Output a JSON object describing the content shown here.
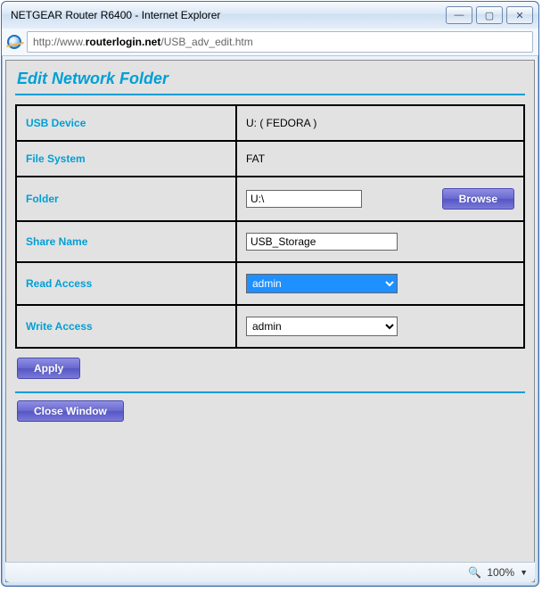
{
  "window": {
    "title": "NETGEAR Router R6400 - Internet Explorer",
    "buttons": {
      "min": "—",
      "max": "▢",
      "close": "✕"
    }
  },
  "address": {
    "scheme": "http://www.",
    "host_bold": "routerlogin.net",
    "path": "/USB_adv_edit.htm"
  },
  "page": {
    "title": "Edit Network Folder",
    "labels": {
      "usb_device": "USB Device",
      "file_system": "File System",
      "folder": "Folder",
      "share_name": "Share Name",
      "read_access": "Read Access",
      "write_access": "Write Access"
    },
    "values": {
      "usb_device": "U: ( FEDORA )",
      "file_system": "FAT",
      "folder": "U:\\",
      "share_name": "USB_Storage",
      "read_access": "admin",
      "write_access": "admin"
    },
    "buttons": {
      "browse": "Browse",
      "apply": "Apply",
      "close_window": "Close Window"
    }
  },
  "statusbar": {
    "zoom_icon": "🔍",
    "zoom": "100%",
    "dropdown": "▼"
  }
}
